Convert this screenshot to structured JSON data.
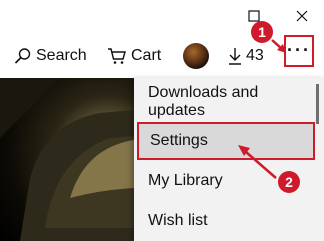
{
  "window_controls": {
    "maximize_icon": "maximize-icon",
    "close_icon": "close-icon"
  },
  "toolbar": {
    "search_label": "Search",
    "cart_label": "Cart",
    "downloads_count": "43",
    "more_label": "···"
  },
  "menu": {
    "items": [
      {
        "label": "Downloads and updates",
        "highlighted": false
      },
      {
        "label": "Settings",
        "highlighted": true
      },
      {
        "label": "My Library",
        "highlighted": false
      },
      {
        "label": "Wish list",
        "highlighted": false
      }
    ]
  },
  "annotations": {
    "step1": "1",
    "step2": "2",
    "color": "#cf1a2b"
  }
}
